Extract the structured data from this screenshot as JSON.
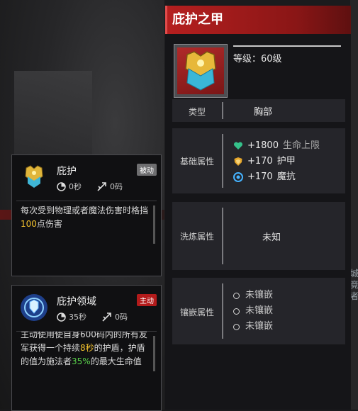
{
  "equipment": {
    "title": "庇护之甲",
    "level_text": "等级：60级",
    "type_label": "类型",
    "type_value": "胸部",
    "base_label": "基础属性",
    "attributes": [
      {
        "icon": "heart-icon",
        "value": "+1800",
        "name": "生命上限"
      },
      {
        "icon": "shield-icon",
        "value": "+170",
        "name": "护甲"
      },
      {
        "icon": "magic-resist-icon",
        "value": "+170",
        "name": "魔抗"
      }
    ],
    "refine_label": "洗炼属性",
    "refine_value": "未知",
    "socket_label": "镶嵌属性",
    "sockets": [
      "未镶嵌",
      "未镶嵌",
      "未镶嵌"
    ]
  },
  "skills": [
    {
      "name": "庇护",
      "tag": "被动",
      "cooldown": "0秒",
      "cost": "0码",
      "desc_parts": [
        {
          "text": "每次受到物理或者魔法伤害时格挡",
          "hl": ""
        },
        {
          "text": "100",
          "hl": "yellow"
        },
        {
          "text": "点伤害",
          "hl": ""
        }
      ]
    },
    {
      "name": "庇护领域",
      "tag": "主动",
      "cooldown": "35秒",
      "cost": "0码",
      "desc_parts": [
        {
          "text": "主动使用使自身600码内的所有友军获得一个持续",
          "hl": ""
        },
        {
          "text": "8秒",
          "hl": "yellow"
        },
        {
          "text": "的护盾，护盾的值为施法者",
          "hl": ""
        },
        {
          "text": "35%",
          "hl": "green"
        },
        {
          "text": "的最大生命值",
          "hl": ""
        }
      ]
    }
  ],
  "background": {
    "side_text": "城\n竟\n者"
  },
  "colors": {
    "accent_red": "#b51f1f",
    "highlight_yellow": "#f2c12e",
    "highlight_green": "#5ad14b"
  }
}
